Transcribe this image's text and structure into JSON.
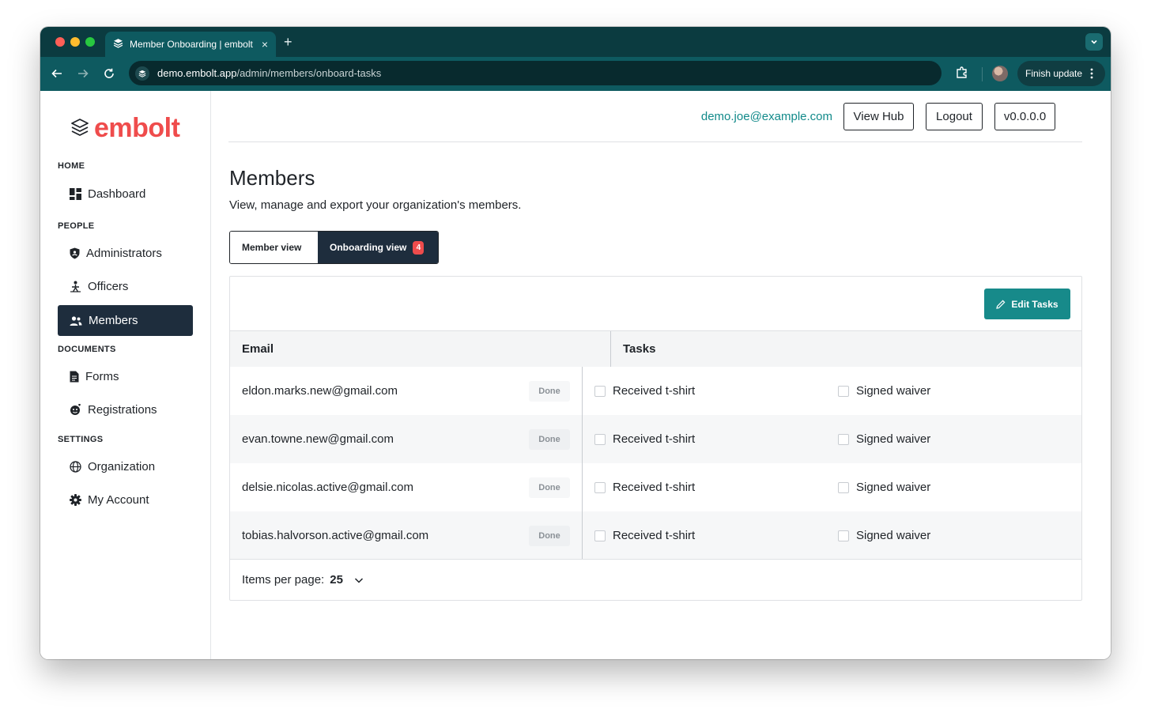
{
  "browser": {
    "tab_title": "Member Onboarding | embolt",
    "tab_close": "×",
    "new_tab": "+",
    "url_host": "demo.embolt.app",
    "url_path": "/admin/members/onboard-tasks",
    "finish_update_label": "Finish update"
  },
  "brand": {
    "name": "embolt",
    "color": "#ef4c4c"
  },
  "sidebar": {
    "sections": [
      {
        "label": "HOME"
      },
      {
        "label": "PEOPLE"
      },
      {
        "label": "DOCUMENTS"
      },
      {
        "label": "SETTINGS"
      }
    ],
    "items": [
      {
        "label": "Dashboard",
        "icon": "dashboard-icon"
      },
      {
        "label": "Administrators",
        "icon": "shield-icon"
      },
      {
        "label": "Officers",
        "icon": "officer-icon"
      },
      {
        "label": "Members",
        "icon": "users-icon",
        "active": true
      },
      {
        "label": "Forms",
        "icon": "file-icon"
      },
      {
        "label": "Registrations",
        "icon": "registration-icon"
      },
      {
        "label": "Organization",
        "icon": "globe-icon"
      },
      {
        "label": "My Account",
        "icon": "gear-icon"
      }
    ]
  },
  "header": {
    "user_email": "demo.joe@example.com",
    "view_hub_label": "View Hub",
    "logout_label": "Logout",
    "version_label": "v0.0.0.0"
  },
  "page": {
    "title": "Members",
    "subtitle": "View, manage and export your organization's members."
  },
  "view_toggle": {
    "member_view_label": "Member view",
    "onboarding_view_label": "Onboarding view",
    "onboarding_badge": "4"
  },
  "card": {
    "edit_tasks_label": "Edit Tasks",
    "columns": {
      "email": "Email",
      "tasks": "Tasks"
    },
    "done_label": "Done",
    "task_labels": [
      "Received t-shirt",
      "Signed waiver"
    ],
    "rows": [
      {
        "email": "eldon.marks.new@gmail.com"
      },
      {
        "email": "evan.towne.new@gmail.com"
      },
      {
        "email": "delsie.nicolas.active@gmail.com"
      },
      {
        "email": "tobias.halvorson.active@gmail.com"
      }
    ],
    "per_page_label": "Items per page:",
    "per_page_value": "25"
  },
  "colors": {
    "accent": "#178a8a",
    "nav_active": "#1e2d3d",
    "browser_frame": "#0e5a60"
  }
}
